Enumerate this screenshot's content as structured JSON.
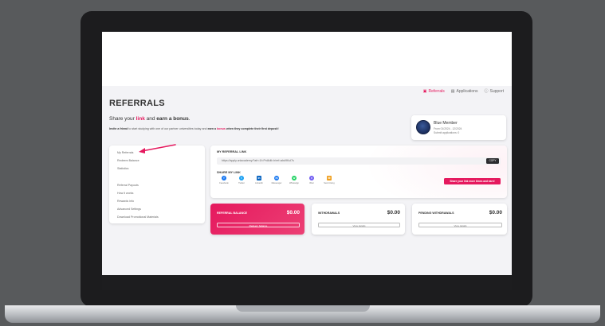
{
  "nav": {
    "referrals": "Referrals",
    "applications": "Applications",
    "support": "Support"
  },
  "page": {
    "title": "REFERRALS",
    "subtitle_a": "Share your ",
    "subtitle_link": "link",
    "subtitle_b": " and ",
    "subtitle_bonus": "earn a bonus",
    "subtitle_end": ".",
    "desc_a": "Invite a friend",
    "desc_b": " to start studying with one of our partner universities today and ",
    "desc_c": "earn a ",
    "desc_bonus": "bonus",
    "desc_d": " when they complete ",
    "desc_e": "their first deposit",
    "desc_end": "!"
  },
  "member": {
    "name": "Blue Member",
    "from": "From 01/2024 - 12/2024",
    "apps": "Submit applications: 0"
  },
  "sidebar": {
    "items": [
      "My Referrals",
      "Redeem Balance",
      "Statistics",
      "Referral Payouts",
      "How it works",
      "Rewards info",
      "Advanced Settings",
      "Download Promotional Materials"
    ]
  },
  "referral_link": {
    "label": "MY REFERRAL LINK",
    "url": "https://apply.uniacademy/?afr=1f=Pnl4dtl=lr/ref=abd9Kul7s",
    "copy": "COPY",
    "share_label": "SHARE MY LINK",
    "share": [
      {
        "label": "Facebook",
        "icon": "f",
        "color": "#1877f2",
        "name": "facebook-icon"
      },
      {
        "label": "Twitter",
        "icon": "t",
        "color": "#1da1f2",
        "name": "twitter-icon"
      },
      {
        "label": "LinkedIn",
        "icon": "in",
        "color": "#0a66c2",
        "name": "linkedin-icon"
      },
      {
        "label": "Messenger",
        "icon": "m",
        "color": "#1e7bf0",
        "name": "messenger-icon"
      },
      {
        "label": "WhatsApp",
        "icon": "w",
        "color": "#25d366",
        "name": "whatsapp-icon"
      },
      {
        "label": "Viber",
        "icon": "v",
        "color": "#7360f2",
        "name": "viber-icon"
      },
      {
        "label": "Send Using",
        "icon": "✉",
        "color": "#f0a020",
        "name": "email-icon"
      }
    ],
    "cta": "Share your link more times and earn!"
  },
  "cards": {
    "referral_balance": {
      "title": "REFERRAL BALANCE",
      "amount": "$0.00",
      "button": "Redeem balance"
    },
    "withdrawals": {
      "title": "WITHDRAWALS",
      "amount": "$0.00",
      "button": "View details"
    },
    "pending": {
      "title": "PENDING WITHDRAWALS",
      "amount": "$0.00",
      "button": "View details"
    }
  },
  "colors": {
    "accent": "#e5195e",
    "arrow": "#e5195e"
  }
}
